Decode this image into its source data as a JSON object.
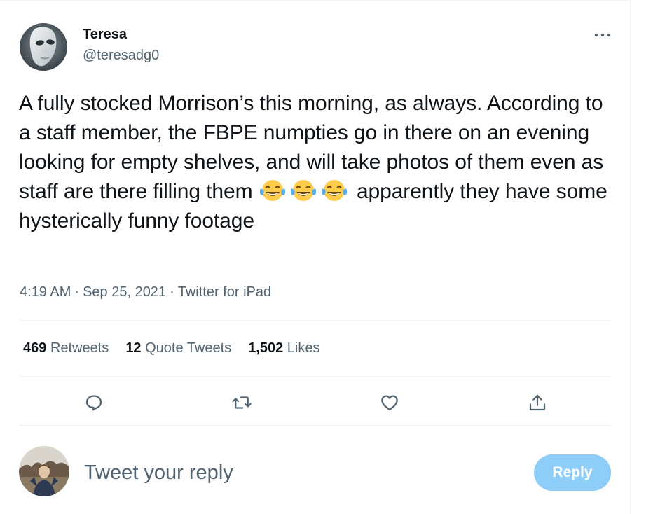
{
  "author": {
    "display_name": "Teresa",
    "handle": "@teresadg0",
    "avatar_icon": "mask-avatar"
  },
  "tweet": {
    "text_part1": "A fully stocked Morrison’s this morning, as always. According to a staff member, the FBPE numpties go in there on an evening looking for empty shelves, and will take photos of them even as staff are there filling them ",
    "emojis": [
      "😂",
      "😂",
      "😂"
    ],
    "text_part2": " apparently they have some hysterically funny footage"
  },
  "meta": {
    "time": "4:19 AM",
    "separator": "·",
    "date": "Sep 25, 2021",
    "source": "Twitter for iPad"
  },
  "stats": {
    "retweets_count": "469",
    "retweets_label": "Retweets",
    "quotes_count": "12",
    "quotes_label": "Quote Tweets",
    "likes_count": "1,502",
    "likes_label": "Likes"
  },
  "actions": {
    "reply_icon": "reply-bubble-icon",
    "retweet_icon": "retweet-icon",
    "like_icon": "heart-icon",
    "share_icon": "share-icon"
  },
  "composer": {
    "placeholder": "Tweet your reply",
    "button_label": "Reply"
  },
  "colors": {
    "secondary_text": "#536471",
    "divider": "#eff3f4",
    "reply_button_disabled": "#8ecdf8"
  }
}
